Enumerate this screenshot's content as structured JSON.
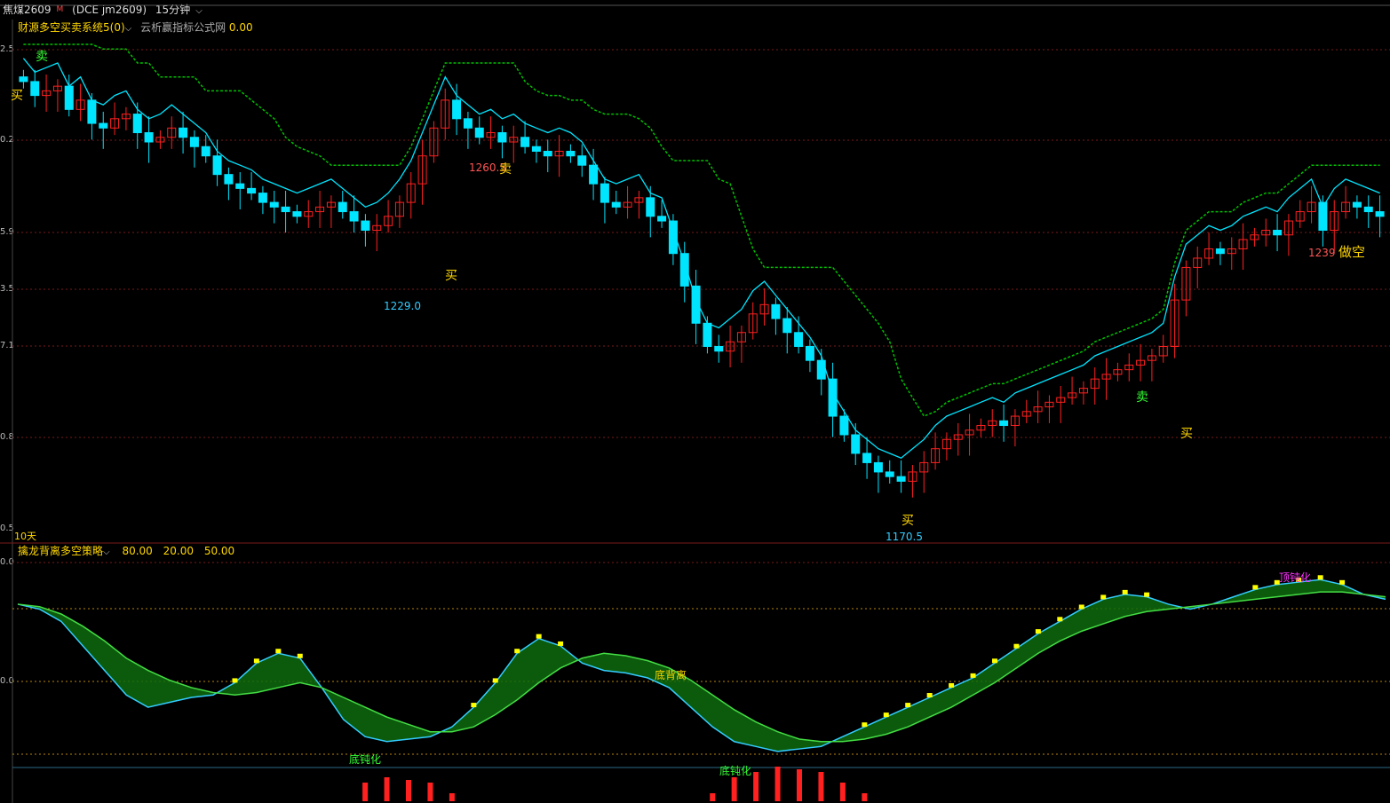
{
  "header": {
    "symbol": "焦煤2609",
    "symbol_mark": "M",
    "code": "(DCE  jm2609)",
    "period": "15分钟"
  },
  "top_indicator": {
    "name": "财源多空买卖系统5(0)",
    "source": "云析赢指标公式网",
    "value": "0.00",
    "footer_label": "10天"
  },
  "bottom_indicator": {
    "name": "擒龙背离多空策略",
    "params": [
      "80.00",
      "20.00",
      "50.00"
    ]
  },
  "y_tick_labels_top": [
    "2.5",
    "0.2",
    "5.9",
    "3.5",
    "7.1",
    "0.8",
    "0.5"
  ],
  "y_tick_labels_bottom": [
    "0.0",
    "0.0"
  ],
  "colors": {
    "bull": "#ff2020",
    "bear": "#00e5ff",
    "green_step": "#00c000",
    "yellow": "#ffff00",
    "purple": "#6a0d6a",
    "green_fill": "#0e6b0e"
  },
  "chart_data": [
    {
      "type": "candlestick",
      "title": "焦煤2609 15分钟",
      "annotations": {
        "price_high_1": "1260.5",
        "price_low_1": "1229.0",
        "price_low_2": "1170.5",
        "price_high_2": "1239",
        "buy_label": "买",
        "sell_label": "卖",
        "short_label": "做空"
      },
      "close": [
        1262,
        1259,
        1260,
        1261,
        1256,
        1258,
        1253,
        1252,
        1254,
        1255,
        1251,
        1249,
        1250,
        1252,
        1250,
        1248,
        1246,
        1242,
        1240,
        1239,
        1238,
        1236,
        1235,
        1234,
        1233,
        1234,
        1235,
        1236,
        1234,
        1232,
        1230,
        1231,
        1233,
        1236,
        1240,
        1246,
        1252,
        1258,
        1254,
        1252,
        1250,
        1251,
        1249,
        1250,
        1248,
        1247,
        1246,
        1247,
        1246,
        1244,
        1240,
        1236,
        1235,
        1236,
        1237,
        1233,
        1232,
        1225,
        1218,
        1210,
        1205,
        1204,
        1206,
        1208,
        1212,
        1214,
        1211,
        1208,
        1205,
        1202,
        1198,
        1190,
        1186,
        1182,
        1180,
        1178,
        1177,
        1176,
        1178,
        1180,
        1183,
        1185,
        1186,
        1187,
        1188,
        1189,
        1188,
        1190,
        1191,
        1192,
        1193,
        1194,
        1195,
        1196,
        1198,
        1199,
        1200,
        1201,
        1202,
        1203,
        1205,
        1215,
        1222,
        1224,
        1226,
        1225,
        1226,
        1228,
        1229,
        1230,
        1229,
        1232,
        1234,
        1236,
        1230,
        1234,
        1236,
        1235,
        1234,
        1233
      ]
    },
    {
      "type": "area",
      "title": "擒龙背离多空策略",
      "annotations": {
        "divergence_bottom": "底背离",
        "bottom_passivation": "底钝化",
        "top_passivation": "顶钝化"
      },
      "fast": [
        72,
        70,
        65,
        55,
        45,
        35,
        30,
        32,
        34,
        35,
        40,
        48,
        52,
        50,
        38,
        25,
        18,
        16,
        17,
        18,
        22,
        30,
        40,
        52,
        58,
        55,
        48,
        45,
        44,
        42,
        38,
        30,
        22,
        16,
        14,
        12,
        13,
        14,
        18,
        22,
        26,
        30,
        34,
        38,
        42,
        48,
        54,
        60,
        65,
        70,
        74,
        76,
        75,
        72,
        70,
        72,
        75,
        78,
        80,
        81,
        82,
        80,
        76,
        74
      ],
      "slow": [
        72,
        71,
        68,
        63,
        57,
        50,
        45,
        41,
        38,
        36,
        35,
        36,
        38,
        40,
        38,
        34,
        30,
        26,
        23,
        20,
        20,
        22,
        27,
        33,
        40,
        46,
        50,
        52,
        51,
        49,
        46,
        41,
        35,
        29,
        24,
        20,
        17,
        16,
        16,
        17,
        19,
        22,
        26,
        30,
        35,
        40,
        46,
        52,
        57,
        61,
        64,
        67,
        69,
        70,
        71,
        72,
        73,
        74,
        75,
        76,
        77,
        77,
        76,
        75
      ]
    }
  ]
}
